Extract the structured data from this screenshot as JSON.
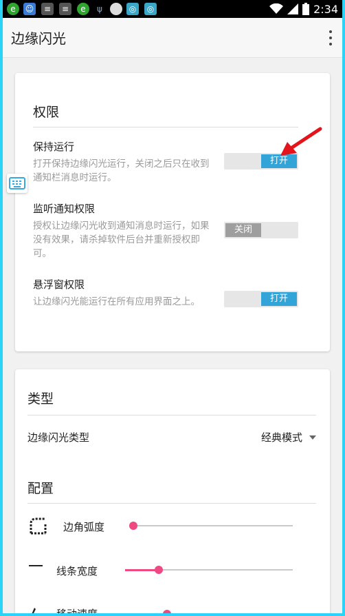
{
  "status_bar": {
    "time": "2:34",
    "icons": [
      "browser-icon",
      "app-icon",
      "message-icon",
      "message-icon",
      "browser-icon",
      "usb-icon",
      "circle-icon",
      "globe-icon",
      "globe-icon",
      "wifi-icon",
      "signal-icon",
      "battery-icon"
    ]
  },
  "app_bar": {
    "title": "边缘闪光",
    "menu_icon": "more-vert-icon"
  },
  "permissions": {
    "title": "权限",
    "items": [
      {
        "title": "保持运行",
        "desc": "打开保持边缘闪光运行，关闭之后只在收到通知栏消息时运行。",
        "toggle": "打开",
        "state": "on"
      },
      {
        "title": "监听通知权限",
        "desc": "授权让边缘闪光收到通知消息时运行，如果没有效果，请杀掉软件后台并重新授权即可。",
        "toggle": "关闭",
        "state": "off"
      },
      {
        "title": "悬浮窗权限",
        "desc": "让边缘闪光能运行在所有应用界面之上。",
        "toggle": "打开",
        "state": "on"
      }
    ]
  },
  "type_section": {
    "title": "类型",
    "label": "边缘闪光类型",
    "value": "经典模式"
  },
  "config": {
    "title": "配置",
    "items": [
      {
        "label": "边角弧度",
        "icon": "rounded-corner-icon",
        "value": 0.0
      },
      {
        "label": "线条宽度",
        "icon": "line-weight-icon",
        "value": 0.2
      },
      {
        "label": "移动速度",
        "icon": "speed-icon",
        "value": 0.25
      }
    ]
  },
  "colors": {
    "accent": "#33a4d8",
    "slider": "#ee4983",
    "annotation_arrow": "#e3141c"
  }
}
